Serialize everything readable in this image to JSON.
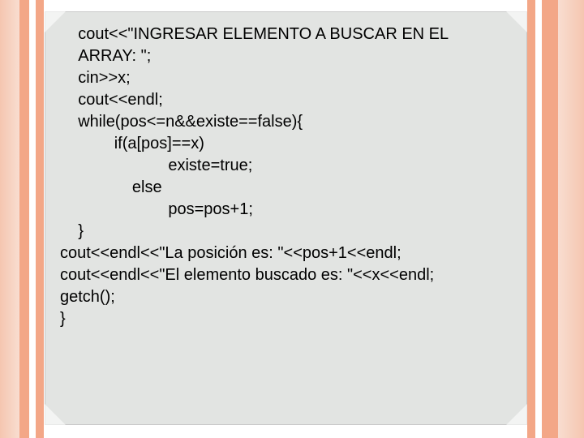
{
  "code": {
    "l1": "    cout<<\"INGRESAR ELEMENTO A BUSCAR EN EL",
    "l2": "    ARRAY: \";",
    "l3": "    cin>>x;",
    "l4": "    cout<<endl;",
    "l5": "    while(pos<=n&&existe==false){",
    "l6": "            if(a[pos]==x)",
    "l7": "                        existe=true;",
    "l8": "                else",
    "l9": "                        pos=pos+1;",
    "l10": "    }",
    "l11": "cout<<endl<<\"La posición es: \"<<pos+1<<endl;",
    "l12": "cout<<endl<<\"El elemento buscado es: \"<<x<<endl;",
    "l13": "getch();",
    "l14": "}"
  },
  "colors": {
    "stripe": "#f3a787",
    "stripe_light": "#f8ddd0",
    "card_bg": "#e2e4e2"
  }
}
